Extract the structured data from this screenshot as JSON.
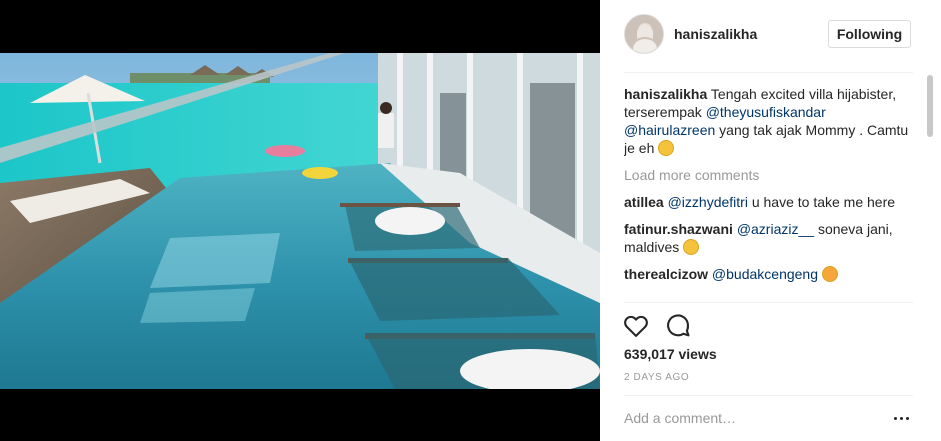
{
  "post": {
    "username": "haniszalikha",
    "follow_label": "Following",
    "caption": {
      "username": "haniszalikha",
      "text_part1": "Tengah excited villa hijabister, terserempak ",
      "mention1": "@theyusufiskandar",
      "mention2": "@hairulazreen",
      "text_part2": " yang tak ajak Mommy . Camtu je eh "
    },
    "load_more": "Load more comments",
    "comments": [
      {
        "user": "atillea",
        "mention": "@izzhydefitri",
        "text": " u have to take me here"
      },
      {
        "user": "fatinur.shazwani",
        "mention": "@azriaziz__",
        "text": " soneva jani, maldives "
      },
      {
        "user": "therealcizow",
        "mention": "@budakcengeng",
        "text": " "
      }
    ],
    "views": "639,017 views",
    "date": "2 DAYS AGO",
    "add_comment_placeholder": "Add a comment…"
  },
  "icons": {
    "like": "heart-outline-icon",
    "comment": "speech-bubble-icon",
    "more": "more-dots-icon",
    "emoji1": "relieved-face-emoji",
    "emoji2": "grinning-face-emoji",
    "emoji3": "kissing-face-emoji"
  },
  "colors": {
    "mention": "#003569",
    "muted": "#999999",
    "text": "#262626",
    "border": "#dbdbdb"
  }
}
